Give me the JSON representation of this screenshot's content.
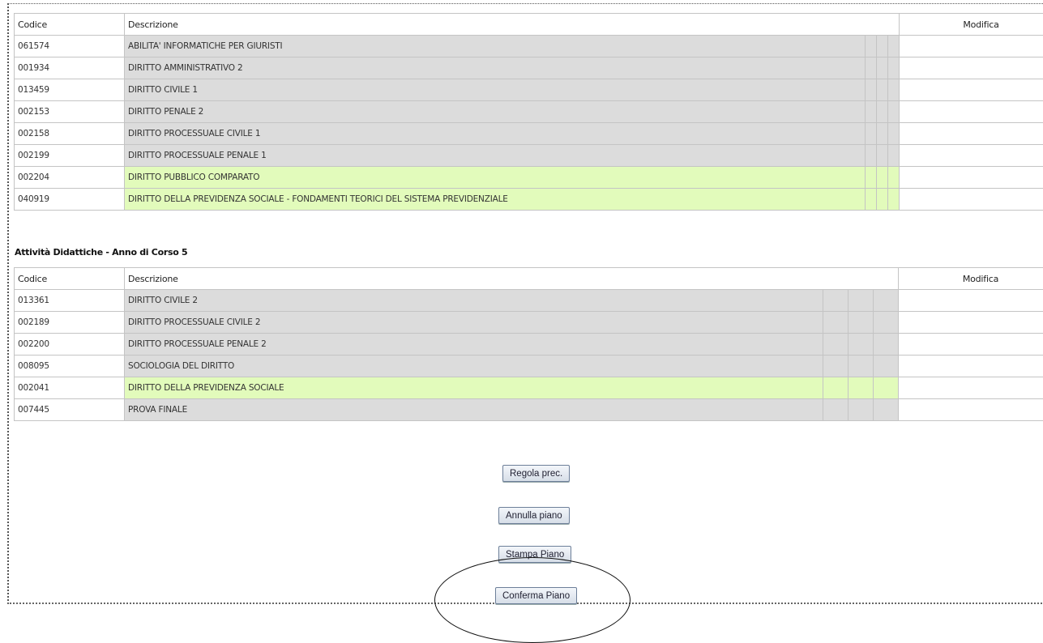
{
  "headers": {
    "code": "Codice",
    "description": "Descrizione",
    "modify": "Modifica"
  },
  "table1": {
    "rows": [
      {
        "code": "061574",
        "description": "ABILITA' INFORMATICHE PER GIURISTI",
        "status": "gray"
      },
      {
        "code": "001934",
        "description": "DIRITTO AMMINISTRATIVO 2",
        "status": "gray"
      },
      {
        "code": "013459",
        "description": "DIRITTO CIVILE 1",
        "status": "gray"
      },
      {
        "code": "002153",
        "description": "DIRITTO PENALE 2",
        "status": "gray"
      },
      {
        "code": "002158",
        "description": "DIRITTO PROCESSUALE CIVILE 1",
        "status": "gray"
      },
      {
        "code": "002199",
        "description": "DIRITTO PROCESSUALE PENALE 1",
        "status": "gray"
      },
      {
        "code": "002204",
        "description": "DIRITTO PUBBLICO COMPARATO",
        "status": "green"
      },
      {
        "code": "040919",
        "description": "DIRITTO DELLA PREVIDENZA SOCIALE - FONDAMENTI TEORICI DEL SISTEMA PREVIDENZIALE",
        "status": "green"
      }
    ]
  },
  "section2_title": "Attività Didattiche - Anno di Corso 5",
  "table2": {
    "rows": [
      {
        "code": "013361",
        "description": "DIRITTO CIVILE 2",
        "status": "gray"
      },
      {
        "code": "002189",
        "description": "DIRITTO PROCESSUALE CIVILE 2",
        "status": "gray"
      },
      {
        "code": "002200",
        "description": "DIRITTO PROCESSUALE PENALE 2",
        "status": "gray"
      },
      {
        "code": "008095",
        "description": "SOCIOLOGIA DEL DIRITTO",
        "status": "gray"
      },
      {
        "code": "002041",
        "description": "DIRITTO DELLA PREVIDENZA SOCIALE",
        "status": "green"
      },
      {
        "code": "007445",
        "description": "PROVA FINALE",
        "status": "gray"
      }
    ]
  },
  "buttons": {
    "prev_rule": "Regola prec.",
    "cancel_plan": "Annulla piano",
    "print_plan": "Stampa  Piano",
    "confirm_plan": "Conferma Piano"
  },
  "colors": {
    "gray_row": "#dcdcdc",
    "green_row": "#e2fbbb"
  }
}
